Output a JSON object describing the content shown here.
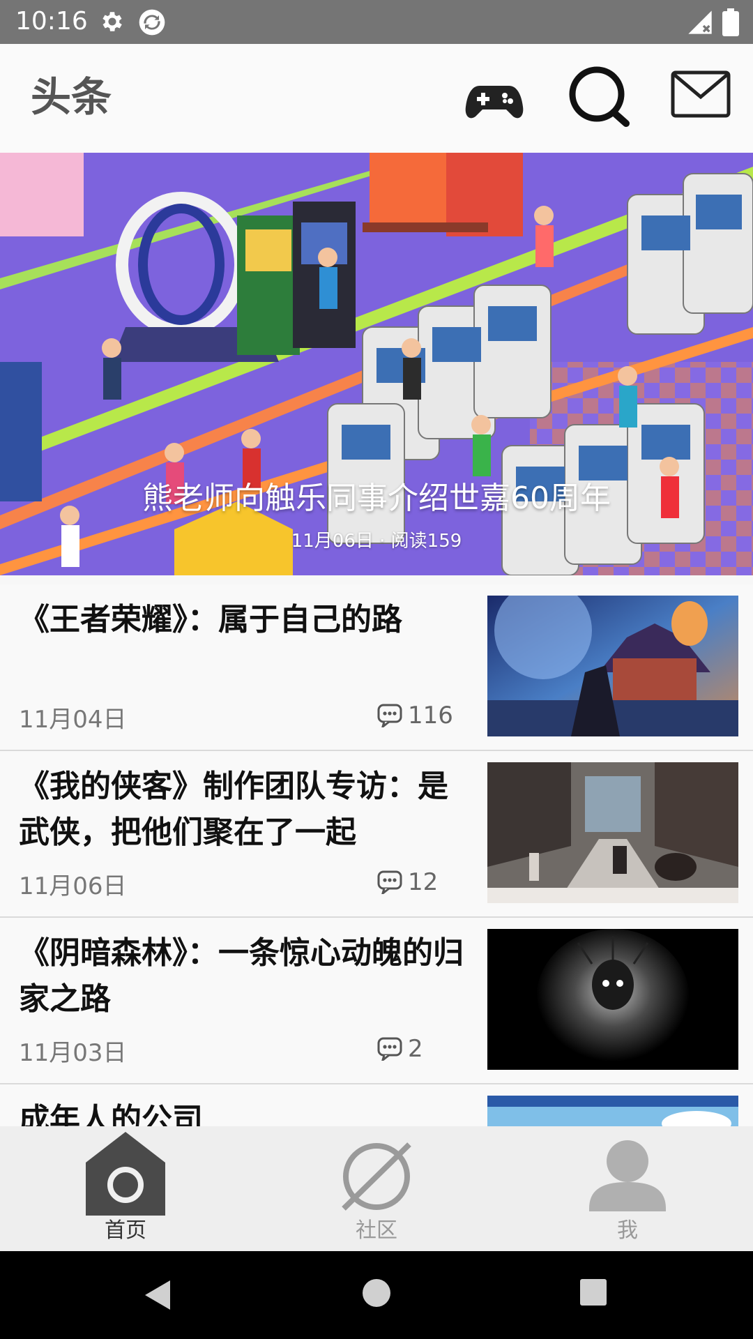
{
  "status_bar": {
    "time": "10:16",
    "icons": [
      "gear-icon",
      "sync-icon",
      "signal-icon",
      "battery-icon"
    ]
  },
  "app_bar": {
    "title": "头条",
    "actions": [
      "gamepad-icon",
      "search-icon",
      "mail-icon"
    ]
  },
  "banner": {
    "title": "熊老师向触乐同事介绍世嘉60周年",
    "meta": "11月06日 · 阅读159"
  },
  "articles": [
    {
      "title": "《王者荣耀》：属于自己的路",
      "date": "11月04日",
      "comments": "116",
      "thumb_theme": "fantasy-festival"
    },
    {
      "title": "《我的侠客》制作团队专访：是武侠，把他们聚在了一起",
      "date": "11月06日",
      "comments": "12",
      "thumb_theme": "wuxia-town"
    },
    {
      "title": "《阴暗森林》：一条惊心动魄的归家之路",
      "date": "11月03日",
      "comments": "2",
      "thumb_theme": "dark-horror"
    },
    {
      "title": "成年人的公司",
      "date": "",
      "comments": "",
      "thumb_theme": "sky"
    }
  ],
  "bottom_nav": {
    "items": [
      {
        "label": "首页",
        "icon": "home-icon",
        "active": true
      },
      {
        "label": "社区",
        "icon": "planet-icon",
        "active": false
      },
      {
        "label": "我",
        "icon": "person-icon",
        "active": false
      }
    ]
  },
  "colors": {
    "status_bar": "#757575",
    "app_bar": "#fafafa",
    "banner_bg": "#7b62d9",
    "nav_active": "#333333",
    "nav_inactive": "#999999"
  }
}
